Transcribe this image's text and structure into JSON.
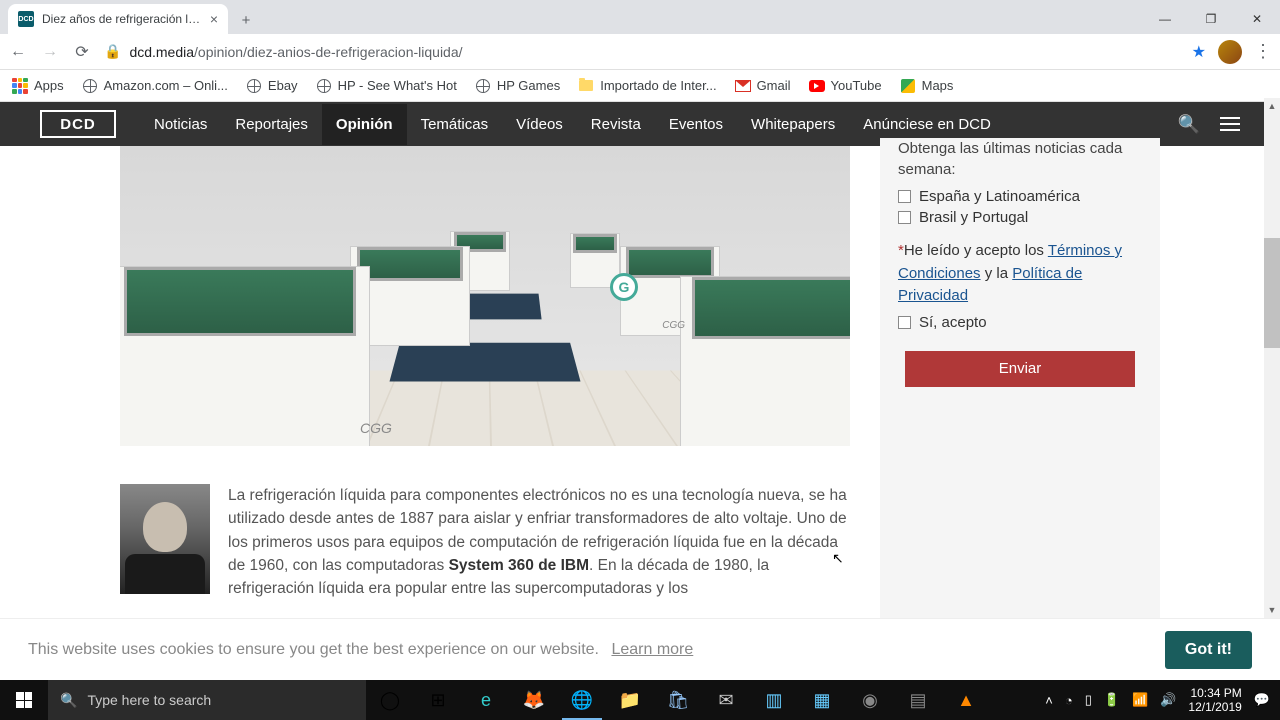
{
  "browser": {
    "tab_title": "Diez años de refrigeración líquid",
    "url_host": "dcd.media",
    "url_path": "/opinion/diez-anios-de-refrigeracion-liquida/",
    "bookmarks": {
      "apps": "Apps",
      "amazon": "Amazon.com – Onli...",
      "ebay": "Ebay",
      "hp": "HP - See What's Hot",
      "hpgames": "HP Games",
      "importado": "Importado de Inter...",
      "gmail": "Gmail",
      "youtube": "YouTube",
      "maps": "Maps"
    }
  },
  "site": {
    "logo": "DCD",
    "nav": [
      "Noticias",
      "Reportajes",
      "Opinión",
      "Temáticas",
      "Vídeos",
      "Revista",
      "Eventos",
      "Whitepapers",
      "Anúnciese en DCD"
    ],
    "active_nav": 2
  },
  "hero": {
    "g": "G",
    "cgg": "CGG"
  },
  "article": {
    "p1a": "La refrigeración líquida para componentes electrónicos no es una tecnología nueva, se ha utilizado desde antes de 1887 para aislar y enfriar transformadores de alto voltaje. Uno de los primeros usos para equipos de computación de refrigeración líquida fue en la década de 1960, con las computadoras ",
    "p1b": "System 360 de IBM",
    "p1c": ". En la década de 1980, la refrigeración líquida era popular entre las supercomputadoras y los"
  },
  "sidebar": {
    "heading": "Obtenga las últimas noticias cada semana:",
    "opt1": "España y Latinoamérica",
    "opt2": "Brasil y Portugal",
    "terms_pre": "He leído y acepto los ",
    "terms_link": "Términos y Condiciones",
    "terms_mid": " y la ",
    "privacy_link": "Política de Privacidad",
    "accept": "Sí, acepto",
    "submit": "Enviar"
  },
  "cookie": {
    "text": "This website uses cookies to ensure you get the best experience on our website.",
    "learn": "Learn more",
    "ok": "Got it!"
  },
  "taskbar": {
    "search_placeholder": "Type here to search",
    "time": "10:34 PM",
    "date": "12/1/2019"
  }
}
